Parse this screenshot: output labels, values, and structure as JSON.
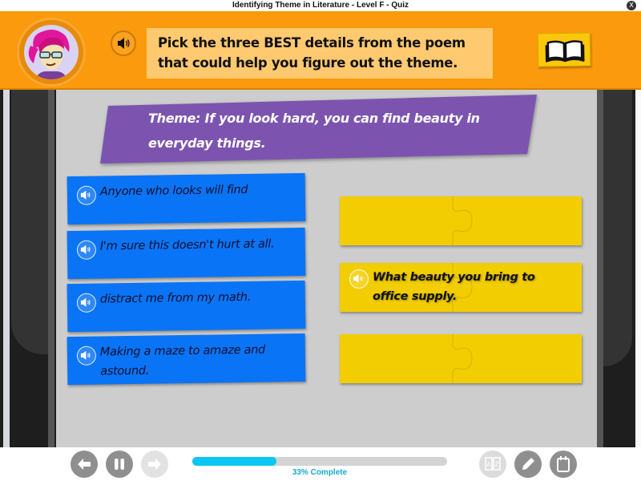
{
  "window": {
    "title": "Identifying Theme in Literature - Level F - Quiz",
    "close_icon": "close-x-icon",
    "close_glyph": "X"
  },
  "header": {
    "avatar": "student-avatar",
    "audio_icon": "speaker-icon",
    "prompt": "Pick the three BEST details from the poem that could help you figure out the theme.",
    "book_icon": "open-book-icon"
  },
  "theme": {
    "text": "Theme: If you look hard, you can find beauty in everyday things.",
    "color": "#7c54b0"
  },
  "options": [
    {
      "text": "Anyone who looks will find",
      "icon": "speaker-icon"
    },
    {
      "text": "I'm sure this doesn't hurt at all.",
      "icon": "speaker-icon"
    },
    {
      "text": "distract me from my math.",
      "icon": "speaker-icon"
    },
    {
      "text": "Making a maze to amaze and astound.",
      "icon": "speaker-icon"
    }
  ],
  "answer_slots": [
    {
      "text": "",
      "filled": false
    },
    {
      "text": "What beauty you bring to office supply.",
      "filled": true,
      "icon": "speaker-icon"
    },
    {
      "text": "",
      "filled": false
    }
  ],
  "footer": {
    "back_icon": "arrow-left-icon",
    "pause_icon": "pause-icon",
    "next_icon": "arrow-right-icon",
    "progress_percent": 33,
    "progress_label": "33% Complete",
    "glossary_icon": "glossary-az-icon",
    "glossary_glyph": "A|Z",
    "pencil_icon": "pencil-icon",
    "notepad_icon": "notepad-icon"
  },
  "colors": {
    "header_orange": "#fb9a0c",
    "prompt_bg": "#fec96f",
    "option_blue": "#0a74f6",
    "slot_yellow": "#f2cd02",
    "progress_cyan": "#0bc6f0",
    "board_gray": "#cdcdcd"
  }
}
